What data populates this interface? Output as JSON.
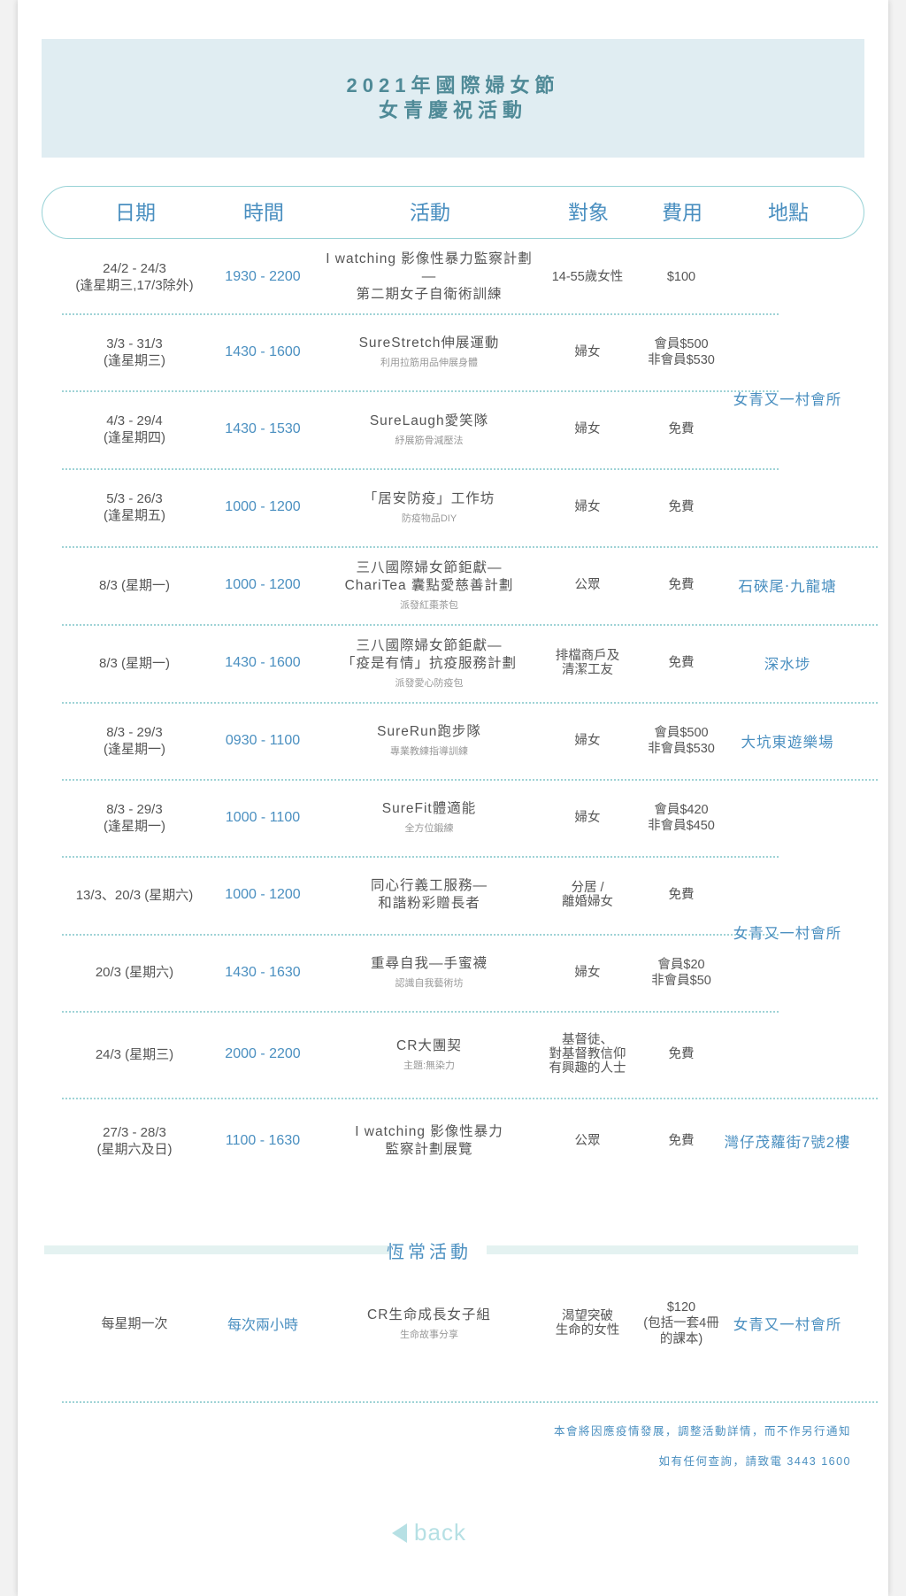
{
  "title": {
    "line1": "2021年國際婦女節",
    "line2": "女青慶祝活動"
  },
  "headers": {
    "date": "日期",
    "time": "時間",
    "activity": "活動",
    "target": "對象",
    "fee": "費用",
    "location": "地點"
  },
  "rows": [
    {
      "date1": "24/2 - 24/3",
      "date2": "(逢星期三,17/3除外)",
      "time": "1930 - 2200",
      "act1": "I watching 影像性暴力監察計劃—",
      "act2": "第二期女子自衛術訓練",
      "sub": "",
      "target1": "14-55歲女性",
      "target2": "",
      "target3": "",
      "fee1": "$100",
      "fee2": "",
      "fee3": ""
    },
    {
      "date1": "3/3 - 31/3",
      "date2": "(逢星期三)",
      "time": "1430 - 1600",
      "act1": "SureStretch伸展運動",
      "act2": "",
      "sub": "利用拉筋用品伸展身體",
      "target1": "婦女",
      "target2": "",
      "target3": "",
      "fee1": "會員$500",
      "fee2": "非會員$530",
      "fee3": ""
    },
    {
      "date1": "4/3 - 29/4",
      "date2": "(逢星期四)",
      "time": "1430 - 1530",
      "act1": "SureLaugh愛笑隊",
      "act2": "",
      "sub": "紓展筋骨減壓法",
      "target1": "婦女",
      "target2": "",
      "target3": "",
      "fee1": "免費",
      "fee2": "",
      "fee3": ""
    },
    {
      "date1": "5/3 - 26/3",
      "date2": "(逢星期五)",
      "time": "1000 - 1200",
      "act1": "「居安防疫」工作坊",
      "act2": "",
      "sub": "防疫物品DIY",
      "target1": "婦女",
      "target2": "",
      "target3": "",
      "fee1": "免費",
      "fee2": "",
      "fee3": ""
    },
    {
      "date1": "8/3 (星期一)",
      "date2": "",
      "time": "1000 - 1200",
      "act1": "三八國際婦女節鉅獻—",
      "act2": "ChariTea 囊點愛慈善計劃",
      "sub": "派發紅棗茶包",
      "target1": "公眾",
      "target2": "",
      "target3": "",
      "fee1": "免費",
      "fee2": "",
      "fee3": "",
      "loc": "石硤尾‧九龍塘"
    },
    {
      "date1": "8/3 (星期一)",
      "date2": "",
      "time": "1430 - 1600",
      "act1": "三八國際婦女節鉅獻—",
      "act2": "「疫是有情」抗疫服務計劃",
      "sub": "派發愛心防疫包",
      "target1": "排檔商戶及",
      "target2": "清潔工友",
      "target3": "",
      "fee1": "免費",
      "fee2": "",
      "fee3": "",
      "loc": "深水埗"
    },
    {
      "date1": "8/3 - 29/3",
      "date2": "(逢星期一)",
      "time": "0930 - 1100",
      "act1": "SureRun跑步隊",
      "act2": "",
      "sub": "專業教練指導訓練",
      "target1": "婦女",
      "target2": "",
      "target3": "",
      "fee1": "會員$500",
      "fee2": "非會員$530",
      "fee3": "",
      "loc": "大坑東遊樂場"
    },
    {
      "date1": "8/3 - 29/3",
      "date2": "(逢星期一)",
      "time": "1000 - 1100",
      "act1": "SureFit體適能",
      "act2": "",
      "sub": "全方位鍛練",
      "target1": "婦女",
      "target2": "",
      "target3": "",
      "fee1": "會員$420",
      "fee2": "非會員$450",
      "fee3": ""
    },
    {
      "date1": "13/3、20/3 (星期六)",
      "date2": "",
      "time": "1000 - 1200",
      "act1": "同心行義工服務—",
      "act2": "和諧粉彩贈長者",
      "sub": "",
      "target1": "分居 /",
      "target2": "離婚婦女",
      "target3": "",
      "fee1": "免費",
      "fee2": "",
      "fee3": ""
    },
    {
      "date1": "20/3 (星期六)",
      "date2": "",
      "time": "1430 - 1630",
      "act1": "重尋自我—手蜜襪",
      "act2": "",
      "sub": "認識自我藝術坊",
      "target1": "婦女",
      "target2": "",
      "target3": "",
      "fee1": "會員$20",
      "fee2": "非會員$50",
      "fee3": ""
    },
    {
      "date1": "24/3 (星期三)",
      "date2": "",
      "time": "2000 - 2200",
      "act1": "CR大團契",
      "act2": "",
      "sub": "主題:無染力",
      "target1": "基督徒、",
      "target2": "對基督教信仰",
      "target3": "有興趣的人士",
      "fee1": "免費",
      "fee2": "",
      "fee3": ""
    },
    {
      "date1": "27/3 - 28/3",
      "date2": "(星期六及日)",
      "time": "1100 - 1630",
      "act1": "I watching 影像性暴力",
      "act2": "監察計劃展覽",
      "sub": "",
      "target1": "公眾",
      "target2": "",
      "target3": "",
      "fee1": "免費",
      "fee2": "",
      "fee3": "",
      "loc": "灣仔茂蘿街7號2樓"
    }
  ],
  "merged_locations": {
    "a": "女青又一村會所",
    "b": "女青又一村會所"
  },
  "regular": {
    "title": "恆常活動",
    "row": {
      "date1": "每星期一次",
      "time": "每次兩小時",
      "act1": "CR生命成長女子組",
      "sub": "生命故事分享",
      "target1": "渴望突破",
      "target2": "生命的女性",
      "fee1": "$120",
      "fee2": "(包括一套4冊",
      "fee3": "的課本)",
      "loc": "女青又一村會所"
    }
  },
  "notes": {
    "line1": "本會將因應疫情發展，調整活動詳情，而不作另行通知",
    "line2": "如有任何查詢，請致電 3443 1600"
  },
  "back_label": "back",
  "icons": {
    "back": "back-triangle-icon"
  },
  "colors": {
    "accent": "#4a8fc0",
    "banner": "#e0edf2",
    "dotted": "#9fd3d6",
    "back": "#b6e0e4"
  }
}
